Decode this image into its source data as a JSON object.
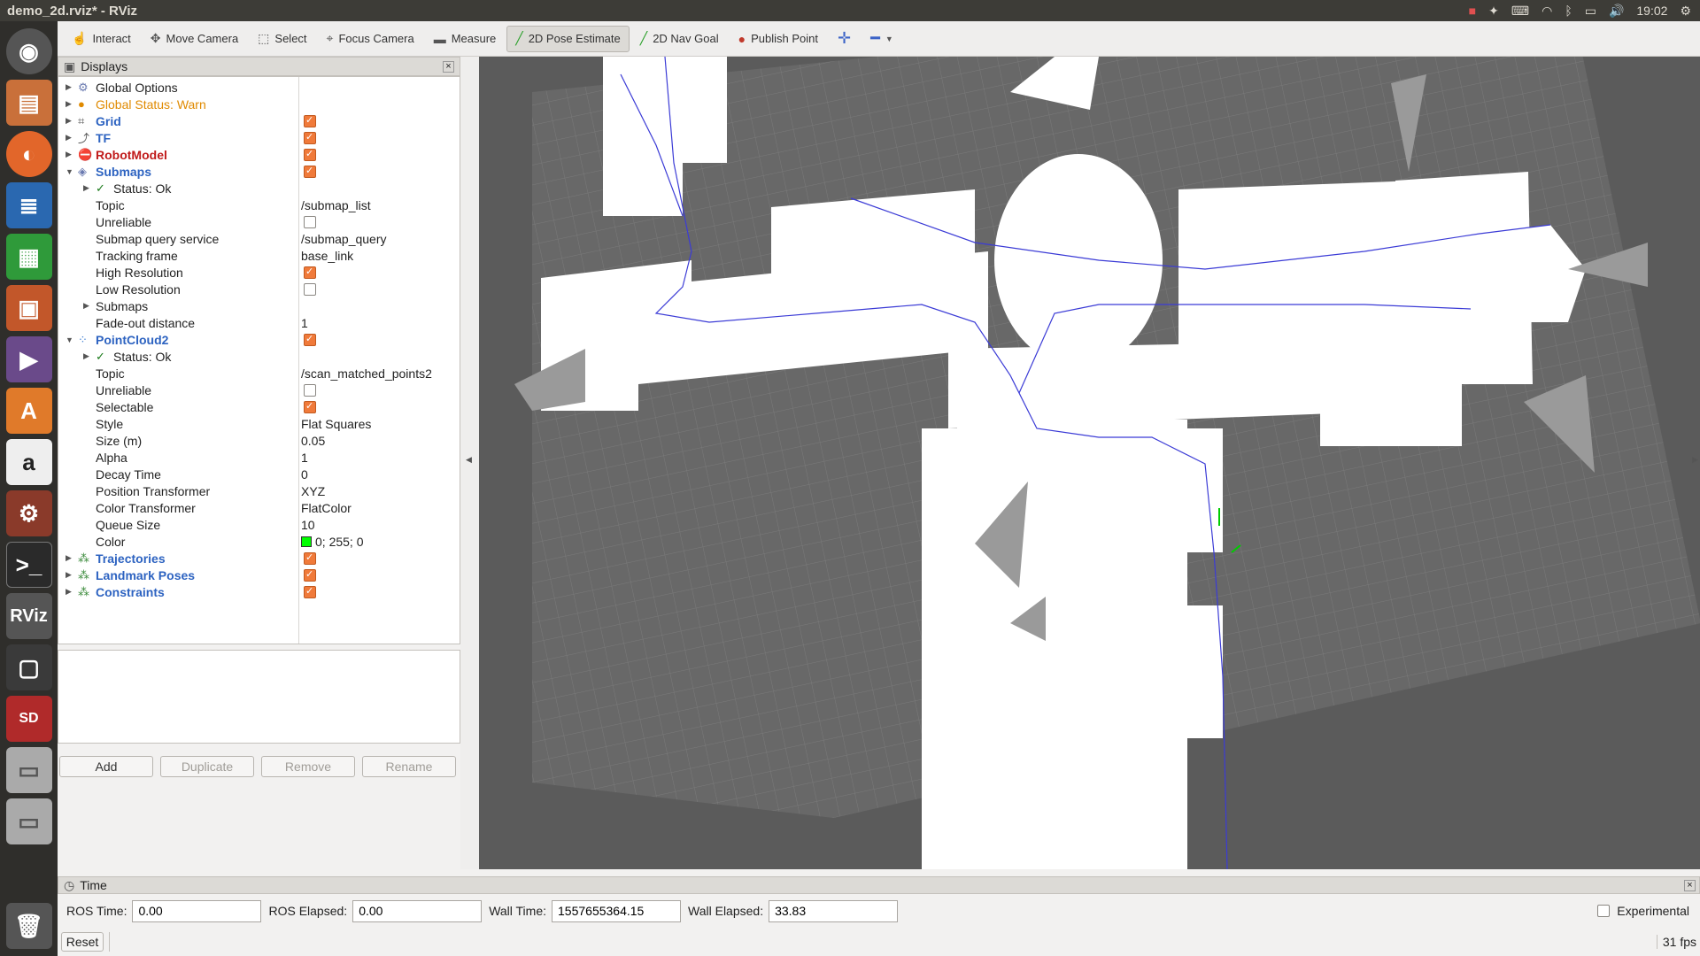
{
  "window": {
    "title": "demo_2d.rviz* - RViz",
    "clock": "19:02"
  },
  "toolbar": {
    "tools": [
      {
        "label": "Interact",
        "icon": "hand-icon"
      },
      {
        "label": "Move Camera",
        "icon": "move-icon"
      },
      {
        "label": "Select",
        "icon": "select-icon"
      },
      {
        "label": "Focus Camera",
        "icon": "focus-icon"
      },
      {
        "label": "Measure",
        "icon": "ruler-icon"
      },
      {
        "label": "2D Pose Estimate",
        "icon": "arrow-icon"
      },
      {
        "label": "2D Nav Goal",
        "icon": "arrow-icon"
      },
      {
        "label": "Publish Point",
        "icon": "pin-icon"
      }
    ]
  },
  "displays": {
    "title": "Displays",
    "rows": [
      {
        "name": "Global Options"
      },
      {
        "name": "Global Status: Warn"
      },
      {
        "name": "Grid"
      },
      {
        "name": "TF"
      },
      {
        "name": "RobotModel"
      },
      {
        "name": "Submaps"
      },
      {
        "name": "Status: Ok"
      },
      {
        "name": "Topic",
        "value": "/submap_list"
      },
      {
        "name": "Unreliable"
      },
      {
        "name": "Submap query service",
        "value": "/submap_query"
      },
      {
        "name": "Tracking frame",
        "value": "base_link"
      },
      {
        "name": "High Resolution"
      },
      {
        "name": "Low Resolution"
      },
      {
        "name": "Submaps"
      },
      {
        "name": "Fade-out distance",
        "value": "1"
      },
      {
        "name": "PointCloud2"
      },
      {
        "name": "Status: Ok"
      },
      {
        "name": "Topic",
        "value": "/scan_matched_points2"
      },
      {
        "name": "Unreliable"
      },
      {
        "name": "Selectable"
      },
      {
        "name": "Style",
        "value": "Flat Squares"
      },
      {
        "name": "Size (m)",
        "value": "0.05"
      },
      {
        "name": "Alpha",
        "value": "1"
      },
      {
        "name": "Decay Time",
        "value": "0"
      },
      {
        "name": "Position Transformer",
        "value": "XYZ"
      },
      {
        "name": "Color Transformer",
        "value": "FlatColor"
      },
      {
        "name": "Queue Size",
        "value": "10"
      },
      {
        "name": "Color",
        "value": "0; 255; 0"
      },
      {
        "name": "Trajectories"
      },
      {
        "name": "Landmark Poses"
      },
      {
        "name": "Constraints"
      }
    ],
    "buttons": {
      "add": "Add",
      "duplicate": "Duplicate",
      "remove": "Remove",
      "rename": "Rename"
    }
  },
  "time": {
    "title": "Time",
    "ros_time_label": "ROS Time:",
    "ros_time": "0.00",
    "ros_elapsed_label": "ROS Elapsed:",
    "ros_elapsed": "0.00",
    "wall_time_label": "Wall Time:",
    "wall_time": "1557655364.15",
    "wall_elapsed_label": "Wall Elapsed:",
    "wall_elapsed": "33.83",
    "experimental_label": "Experimental"
  },
  "status": {
    "reset": "Reset",
    "fps": "31 fps"
  },
  "colors": {
    "accent": "#f07a3a",
    "viewport_bg": "#5b5b5b",
    "pointcloud_color": "#00ff00",
    "trajectory": "#3b3bd6"
  }
}
